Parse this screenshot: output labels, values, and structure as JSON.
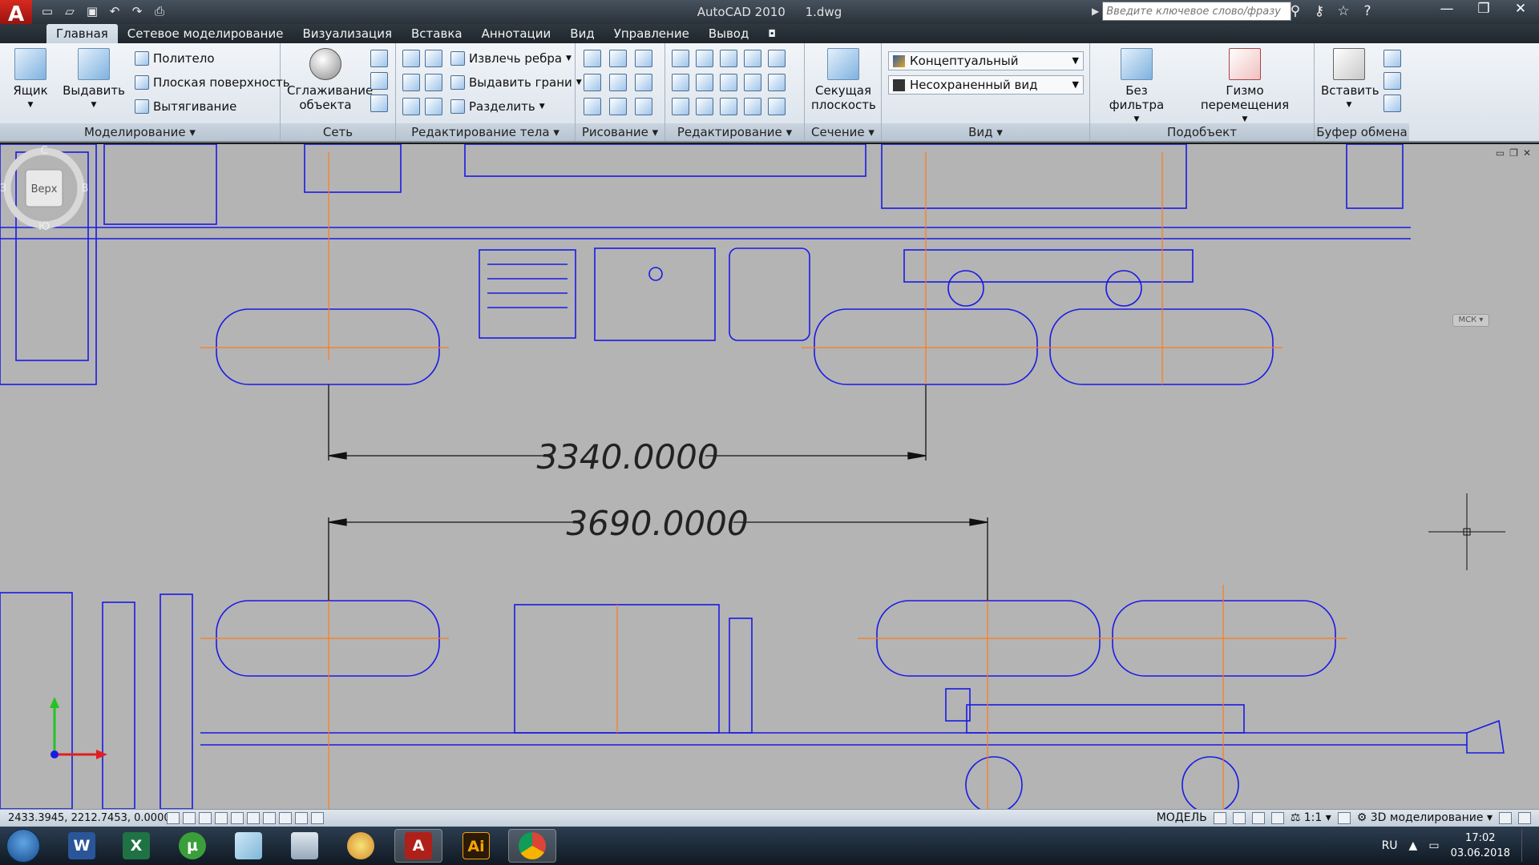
{
  "titlebar": {
    "app_logo": "A",
    "app_name": "AutoCAD 2010",
    "file_name": "1.dwg",
    "search_placeholder": "Введите ключевое слово/фразу",
    "qat_icons": [
      "new-icon",
      "open-icon",
      "save-icon",
      "undo-icon",
      "redo-icon",
      "plot-icon"
    ],
    "infocenter_icons": [
      "binoculars-icon",
      "key-icon",
      "star-icon",
      "help-icon"
    ],
    "window_controls": [
      "minimize",
      "restore",
      "close"
    ]
  },
  "ribbon": {
    "tabs": [
      "Главная",
      "Сетевое моделирование",
      "Визуализация",
      "Вставка",
      "Аннотации",
      "Вид",
      "Управление",
      "Вывод"
    ],
    "active_tab": "Главная",
    "panels": {
      "modeling": {
        "title": "Моделирование",
        "box": "Ящик",
        "extrude": "Выдавить",
        "polysolid": "Политело",
        "planar_surface": "Плоская поверхность",
        "sweep": "Вытягивание"
      },
      "mesh": {
        "title": "Сеть",
        "smooth": "Сглаживание объекта"
      },
      "solid_editing": {
        "title": "Редактирование тела",
        "extract_edges": "Извлечь ребра",
        "extrude_faces": "Выдавить грани",
        "separate": "Разделить"
      },
      "draw": {
        "title": "Рисование"
      },
      "modify": {
        "title": "Редактирование"
      },
      "section": {
        "title": "Сечение",
        "section_plane": "Секущая плоскость"
      },
      "view": {
        "title": "Вид",
        "visual_style": "Концептуальный",
        "named_view": "Несохраненный вид"
      },
      "subobject": {
        "title": "Подобъект",
        "no_filter": "Без фильтра",
        "move_gizmo": "Гизмо перемещения"
      },
      "clipboard": {
        "title": "Буфер обмена",
        "paste": "Вставить"
      }
    }
  },
  "drawing": {
    "dim_top": "3340.0000",
    "dim_bottom": "3690.0000",
    "viewcube": {
      "face": "Верх",
      "north": "С",
      "south": "Ю",
      "west": "З",
      "east": "В"
    },
    "ucs_label": "МСК",
    "colors": {
      "background": "#b4b4b4",
      "geometry": "#1a1ae6",
      "centerline": "#ff7a1a",
      "dimension": "#111111"
    }
  },
  "statusbar": {
    "coordinates": "2433.3945, 2212.7453, 0.0000",
    "model": "МОДЕЛЬ",
    "scale": "1:1",
    "workspace": "3D моделирование"
  },
  "taskbar": {
    "apps": [
      "windows-start",
      "word",
      "excel",
      "utorrent",
      "notes",
      "calculator",
      "paint",
      "autocad",
      "illustrator",
      "chrome"
    ],
    "language": "RU",
    "time": "17:02",
    "date": "03.06.2018"
  }
}
